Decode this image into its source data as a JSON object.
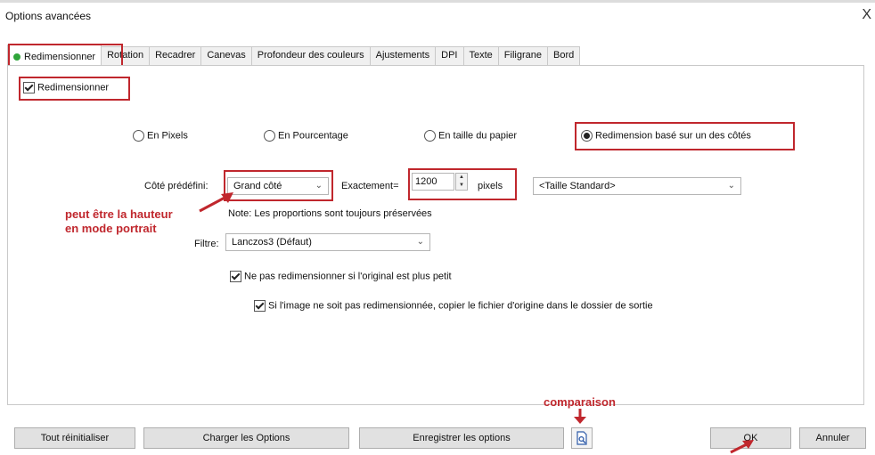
{
  "window": {
    "title": "Options avancées",
    "close": "X"
  },
  "tabs": [
    "Redimensionner",
    "Rotation",
    "Recadrer",
    "Canevas",
    "Profondeur des couleurs",
    "Ajustements",
    "DPI",
    "Texte",
    "Filigrane",
    "Bord"
  ],
  "resize": {
    "enable_label": "Redimensionner",
    "enable_checked": true,
    "modes": [
      {
        "label": "En Pixels",
        "checked": false
      },
      {
        "label": "En Pourcentage",
        "checked": false
      },
      {
        "label": "En taille du papier",
        "checked": false
      },
      {
        "label": "Redimension basé sur un des côtés",
        "checked": true
      }
    ],
    "side_label": "Côté prédéfini:",
    "side_value": "Grand côté",
    "exact_label": "Exactement=",
    "exact_value": "1200",
    "unit_label": "pixels",
    "standard_value": "<Taille Standard>",
    "note": "Note: Les proportions sont toujours préservées",
    "filter_label": "Filtre:",
    "filter_value": "Lanczos3 (Défaut)",
    "no_upscale_label": "Ne pas redimensionner si l'original est plus petit",
    "no_upscale_checked": true,
    "copy_label": "Si l'image ne soit pas redimensionnée, copier le fichier d'origine dans le dossier de sortie",
    "copy_checked": true
  },
  "annotations": {
    "portrait_line1": "peut être la hauteur",
    "portrait_line2": "en mode portrait",
    "compare": "comparaison",
    "color": "#c0272d"
  },
  "buttons": {
    "reset": "Tout réinitialiser",
    "load": "Charger les Options",
    "save": "Enregistrer les options",
    "ok": "OK",
    "cancel": "Annuler"
  },
  "icons": {
    "compare": "compare-preview-icon",
    "active_tab": "green-dot-icon"
  }
}
